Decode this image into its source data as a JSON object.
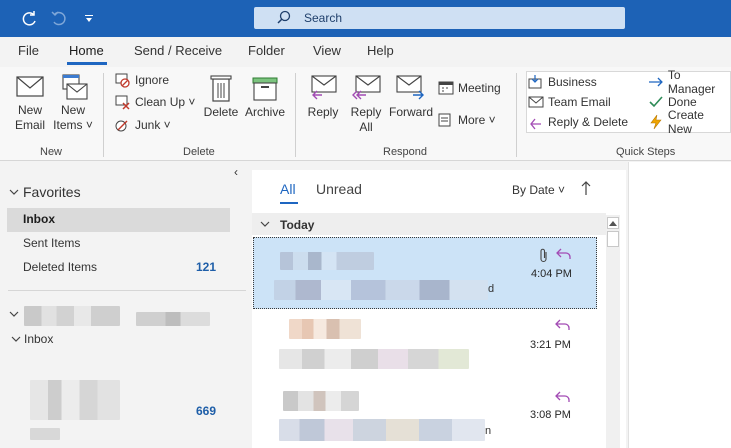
{
  "search": {
    "placeholder": "Search"
  },
  "menu": {
    "tabs": [
      "File",
      "Home",
      "Send / Receive",
      "Folder",
      "View",
      "Help"
    ],
    "active": "Home"
  },
  "ribbon": {
    "new_group": {
      "label": "New",
      "new_email": [
        "New",
        "Email"
      ],
      "new_items": [
        "New",
        "Items ˅"
      ]
    },
    "delete_group": {
      "label": "Delete",
      "ignore": "Ignore",
      "clean_up": "Clean Up ˅",
      "junk": "Junk ˅",
      "delete": "Delete",
      "archive": "Archive"
    },
    "respond_group": {
      "label": "Respond",
      "reply": "Reply",
      "reply_all": [
        "Reply",
        "All"
      ],
      "forward": "Forward",
      "meeting": "Meeting",
      "more": "More ˅"
    },
    "quick_steps": {
      "label": "Quick Steps",
      "items": [
        "Business",
        "Team Email",
        "Reply & Delete",
        "To Manager",
        "Done",
        "Create New"
      ]
    }
  },
  "folders": {
    "favorites_label": "Favorites",
    "favorites": [
      {
        "name": "Inbox",
        "count": ""
      },
      {
        "name": "Sent Items",
        "count": ""
      },
      {
        "name": "Deleted Items",
        "count": "121"
      }
    ],
    "account_inbox": "Inbox",
    "account_count": "669"
  },
  "message_list": {
    "filter_all": "All",
    "filter_unread": "Unread",
    "sort": "By Date ˅",
    "group": "Today",
    "messages": [
      {
        "time": "4:04 PM",
        "tail": "d"
      },
      {
        "time": "3:21 PM",
        "tail": ""
      },
      {
        "time": "3:08 PM",
        "tail": "n"
      }
    ]
  },
  "colors": {
    "accent": "#1e66c1",
    "titlebar": "#1d62b6",
    "selection": "#cce3f7",
    "reply_icon": "#a24bb4"
  }
}
